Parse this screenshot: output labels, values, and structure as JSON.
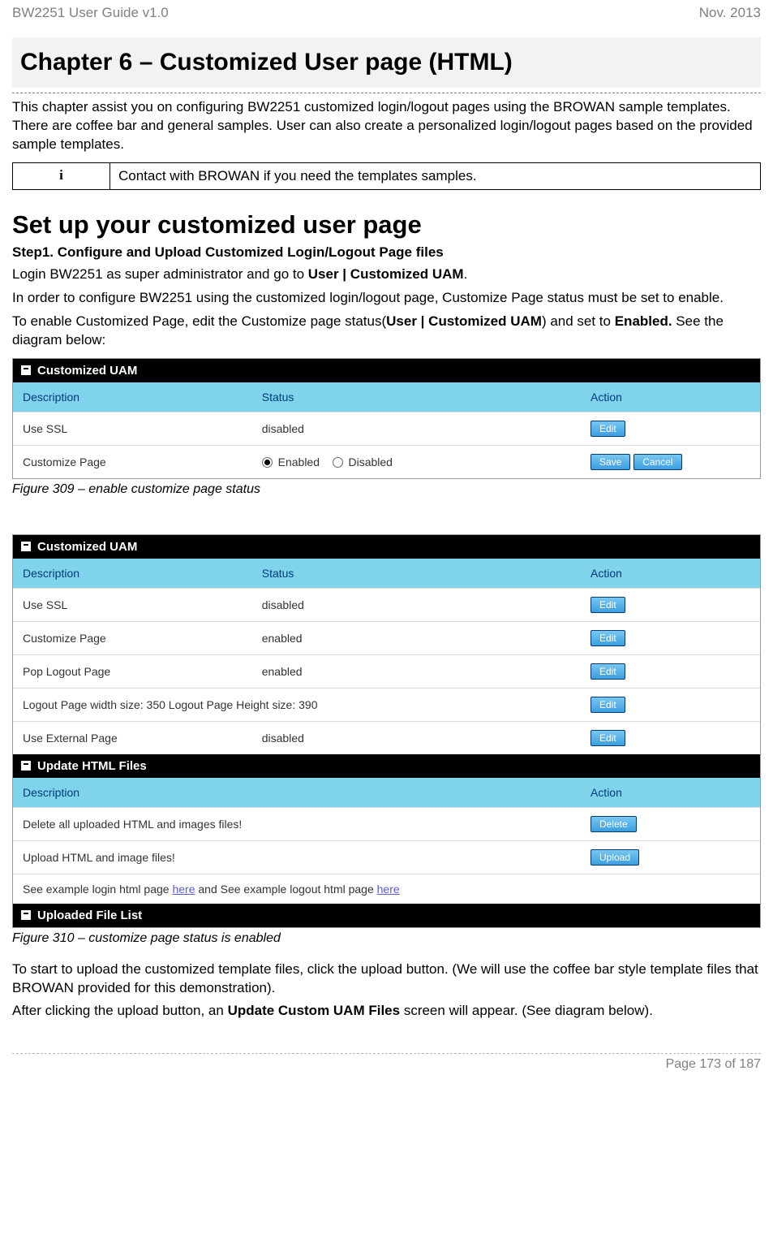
{
  "header": {
    "left": "BW2251 User Guide v1.0",
    "right": "Nov.  2013"
  },
  "chapter": "Chapter 6 – Customized User page (HTML)",
  "intro": "This chapter assist you on configuring BW2251 customized login/logout pages using the BROWAN sample templates. There are coffee bar and general samples. User can also create a personalized login/logout pages based on the provided sample templates.",
  "info_icon": "i",
  "info_text": "Contact with BROWAN if you need the templates samples.",
  "section": "Set up your customized user page",
  "step1": "Step1.  Configure and Upload Customized Login/Logout Page files",
  "p1a": "Login BW2251 as super administrator and go to ",
  "p1b": "User | Customized UAM",
  "p1c": ".",
  "p2": "In order to configure BW2251 using the customized login/logout page, Customize Page status must be set to enable.",
  "p3a": "To enable Customized Page, edit the Customize page status(",
  "p3b": "User | Customized UAM",
  "p3c": ") and set to ",
  "p3d": "Enabled.",
  "p3e": "  See the diagram below:",
  "fig1": {
    "panel_title": "Customized UAM",
    "hdr_desc": "Description",
    "hdr_status": "Status",
    "hdr_action": "Action",
    "rows": [
      {
        "desc": "Use SSL",
        "status": "disabled",
        "buttons": [
          "Edit"
        ]
      },
      {
        "desc": "Customize Page",
        "radio1": "Enabled",
        "radio2": "Disabled",
        "buttons": [
          "Save",
          "Cancel"
        ]
      }
    ],
    "caption": "Figure 309  – enable customize page status"
  },
  "fig2": {
    "panel1_title": "Customized UAM",
    "hdr_desc": "Description",
    "hdr_status": "Status",
    "hdr_action": "Action",
    "rows1": [
      {
        "desc": "Use SSL",
        "status": "disabled",
        "btn": "Edit"
      },
      {
        "desc": "Customize Page",
        "status": "enabled",
        "btn": "Edit"
      },
      {
        "desc": "Pop Logout Page",
        "status": "enabled",
        "btn": "Edit"
      },
      {
        "desc": "Logout Page width size: 350  Logout Page Height size: 390",
        "status": "",
        "btn": "Edit"
      },
      {
        "desc": "Use External Page",
        "status": "disabled",
        "btn": "Edit"
      }
    ],
    "panel2_title": "Update HTML Files",
    "hdr_desc2": "Description",
    "hdr_action2": "Action",
    "rows2": [
      {
        "desc": "Delete all uploaded HTML and images files!",
        "btn": "Delete"
      },
      {
        "desc": "Upload HTML and image files!",
        "btn": "Upload"
      }
    ],
    "example_a": "See example login html page ",
    "example_link1": "here",
    "example_b": " and See example logout html page ",
    "example_link2": "here",
    "panel3_title": "Uploaded File List",
    "caption": "Figure 310  – customize page status is enabled"
  },
  "p4": "To start to upload the customized template files, click the upload button.  (We will use the coffee bar style template files that BROWAN provided for this demonstration).",
  "p5a": "After clicking the upload button, an ",
  "p5b": "Update Custom UAM Files",
  "p5c": " screen will appear. (See diagram below).",
  "footer": "Page 173 of 187"
}
